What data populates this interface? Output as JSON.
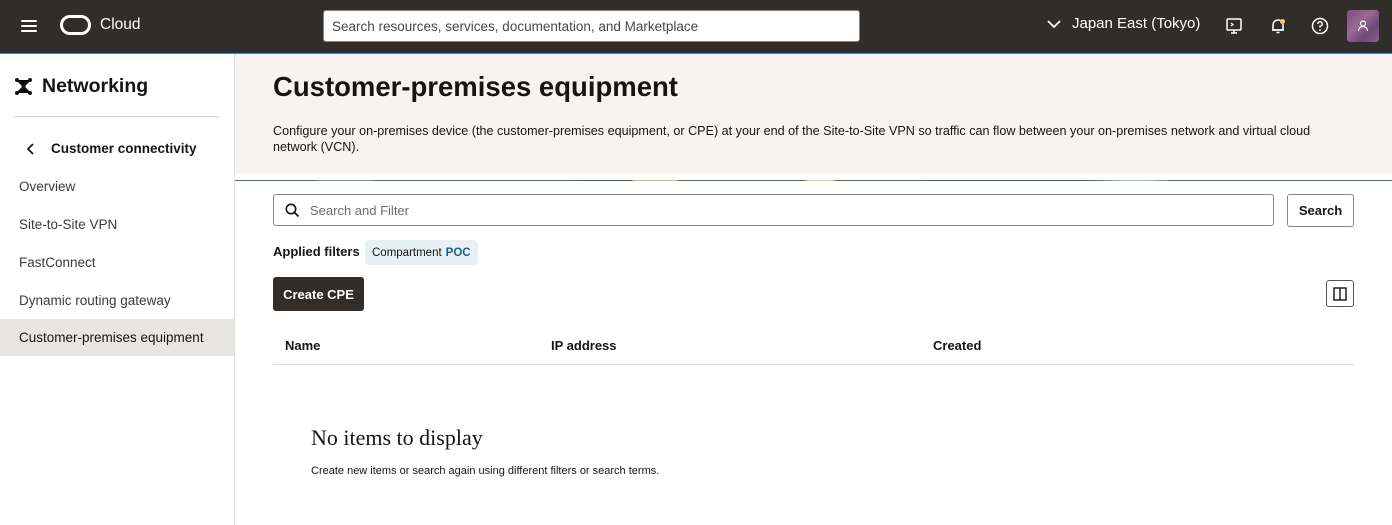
{
  "topbar": {
    "brand": "Cloud",
    "search_placeholder": "Search resources, services, documentation, and Marketplace",
    "region": "Japan East (Tokyo)"
  },
  "sidebar": {
    "title": "Networking",
    "back_label": "Customer connectivity",
    "items": [
      {
        "label": "Overview"
      },
      {
        "label": "Site-to-Site VPN"
      },
      {
        "label": "FastConnect"
      },
      {
        "label": "Dynamic routing gateway"
      },
      {
        "label": "Customer-premises equipment",
        "active": true
      }
    ]
  },
  "main": {
    "title": "Customer-premises equipment",
    "description": "Configure your on-premises device (the customer-premises equipment, or CPE) at your end of the Site-to-Site VPN so traffic can flow between your on-premises network and virtual cloud network (VCN).",
    "filter_placeholder": "Search and Filter",
    "search_button": "Search",
    "applied_filters_label": "Applied filters",
    "filter_chip": {
      "key": "Compartment",
      "value": "POC"
    },
    "create_button": "Create CPE",
    "table": {
      "columns": [
        "Name",
        "IP address",
        "Created"
      ]
    },
    "empty_state": {
      "title": "No items to display",
      "message": "Create new items or search again using different filters or search terms."
    }
  },
  "colors": {
    "topbar": "#312d2a",
    "accent_link": "#1f6086",
    "active_nav": "#e8e6e3",
    "header_bg": "#f5f4f2"
  }
}
